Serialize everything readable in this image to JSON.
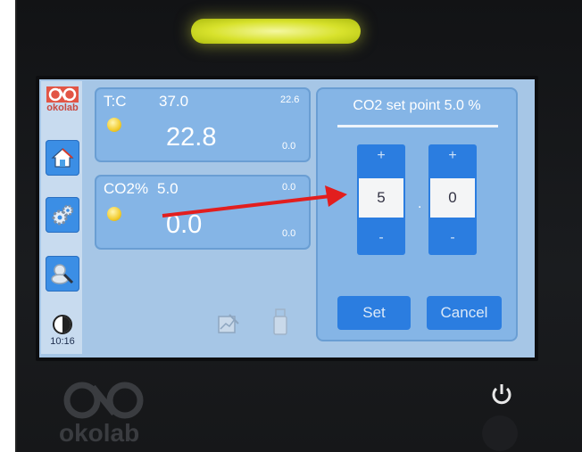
{
  "device": {
    "brand": "okolab",
    "bottom_brand": "okolab"
  },
  "sidebar": {
    "logo_text": "okolab",
    "clock": "10:16",
    "buttons": [
      {
        "name": "home",
        "icon": "home-icon"
      },
      {
        "name": "settings",
        "icon": "gears-icon"
      },
      {
        "name": "search",
        "icon": "magnifier-icon"
      }
    ]
  },
  "temperature": {
    "label": "T:C",
    "setpoint": "37.0",
    "max": "22.6",
    "current": "22.8",
    "min": "0.0"
  },
  "co2": {
    "label": "CO2%",
    "setpoint": "5.0",
    "max": "0.0",
    "current": "0.0",
    "min": "0.0"
  },
  "setpoint_dialog": {
    "title": "CO2 set point 5.0 %",
    "integer_digit": "5",
    "decimal_digit": "0",
    "separator": ".",
    "plus": "+",
    "minus": "-",
    "set_label": "Set",
    "cancel_label": "Cancel"
  },
  "colors": {
    "accent_blue": "#2b7de0",
    "panel_blue": "#85b5e6",
    "annotation_arrow": "#e21e1e",
    "status_led": "#f2cc2e",
    "glow_bar": "#d8e22c"
  }
}
